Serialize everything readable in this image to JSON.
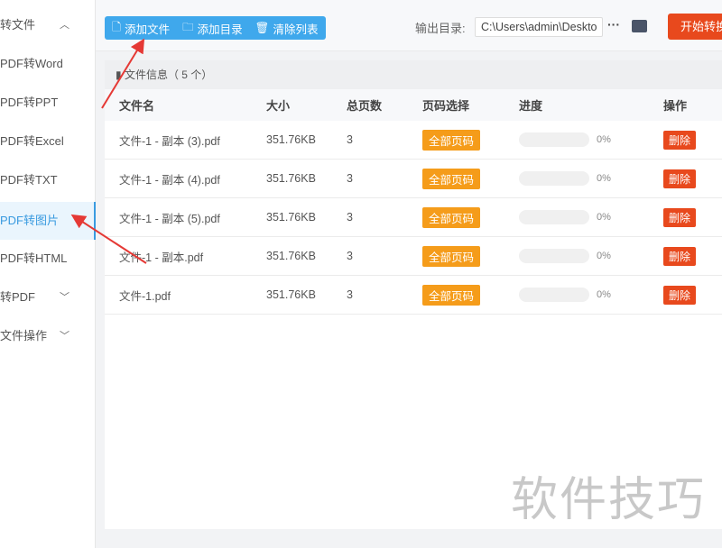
{
  "sidebar": {
    "items": [
      {
        "label": "转文件",
        "chevron": "^"
      },
      {
        "label": "PDF转Word"
      },
      {
        "label": "PDF转PPT"
      },
      {
        "label": "PDF转Excel"
      },
      {
        "label": "PDF转TXT"
      },
      {
        "label": "PDF转图片",
        "active": true
      },
      {
        "label": "PDF转HTML"
      },
      {
        "label": "转PDF",
        "chevron": "v"
      },
      {
        "label": "文件操作",
        "chevron": "v"
      }
    ]
  },
  "toolbar": {
    "add_file": "添加文件",
    "add_folder": "添加目录",
    "clear_list": "清除列表",
    "output_label": "输出目录:",
    "output_path": "C:\\Users\\admin\\Deskto",
    "more": "···",
    "start": "开始转换"
  },
  "panel": {
    "info": "文件信息（ 5 个）",
    "columns": [
      "文件名",
      "大小",
      "总页数",
      "页码选择",
      "进度",
      "操作"
    ],
    "rows": [
      {
        "name": "文件-1 - 副本 (3).pdf",
        "size": "351.76KB",
        "pages": "3",
        "page_sel": "全部页码",
        "progress": 0,
        "progress_text": "0%",
        "action": "删除"
      },
      {
        "name": "文件-1 - 副本 (4).pdf",
        "size": "351.76KB",
        "pages": "3",
        "page_sel": "全部页码",
        "progress": 0,
        "progress_text": "0%",
        "action": "删除"
      },
      {
        "name": "文件-1 - 副本 (5).pdf",
        "size": "351.76KB",
        "pages": "3",
        "page_sel": "全部页码",
        "progress": 0,
        "progress_text": "0%",
        "action": "删除"
      },
      {
        "name": "文件-1 - 副本.pdf",
        "size": "351.76KB",
        "pages": "3",
        "page_sel": "全部页码",
        "progress": 0,
        "progress_text": "0%",
        "action": "删除"
      },
      {
        "name": "文件-1.pdf",
        "size": "351.76KB",
        "pages": "3",
        "page_sel": "全部页码",
        "progress": 0,
        "progress_text": "0%",
        "action": "删除"
      }
    ]
  },
  "watermark": "软件技巧",
  "colors": {
    "accent": "#3fa8ec",
    "danger": "#e8491d",
    "warning": "#f59c1a"
  }
}
